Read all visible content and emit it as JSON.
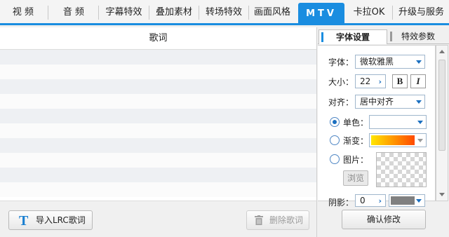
{
  "tabs": [
    {
      "label": "视 频"
    },
    {
      "label": "音 频"
    },
    {
      "label": "字幕特效"
    },
    {
      "label": "叠加素材"
    },
    {
      "label": "转场特效"
    },
    {
      "label": "画面风格"
    },
    {
      "label": "MTV"
    },
    {
      "label": "卡拉OK"
    },
    {
      "label": "升级与服务"
    }
  ],
  "lyrics": {
    "header": "歌词",
    "import_label": "导入LRC歌词",
    "import_icon": "T",
    "delete_label": "删除歌词"
  },
  "settings": {
    "subtabs": [
      {
        "label": "字体设置"
      },
      {
        "label": "特效参数"
      }
    ],
    "font_label": "字体：",
    "font_value": "微软雅黑",
    "size_label": "大小：",
    "size_value": "22",
    "bold_label": "B",
    "italic_label": "I",
    "align_label": "对齐：",
    "align_value": "居中对齐",
    "solid_label": "单色：",
    "gradient_label": "渐变：",
    "gradient_colors": [
      "#ffe600",
      "#ff4a00"
    ],
    "image_label": "图片：",
    "browse_label": "浏览",
    "shadow_label": "阴影：",
    "shadow_value": "0",
    "shadow_color": "#808080",
    "confirm_label": "确认修改"
  },
  "colors": {
    "accent": "#1a8de0"
  }
}
